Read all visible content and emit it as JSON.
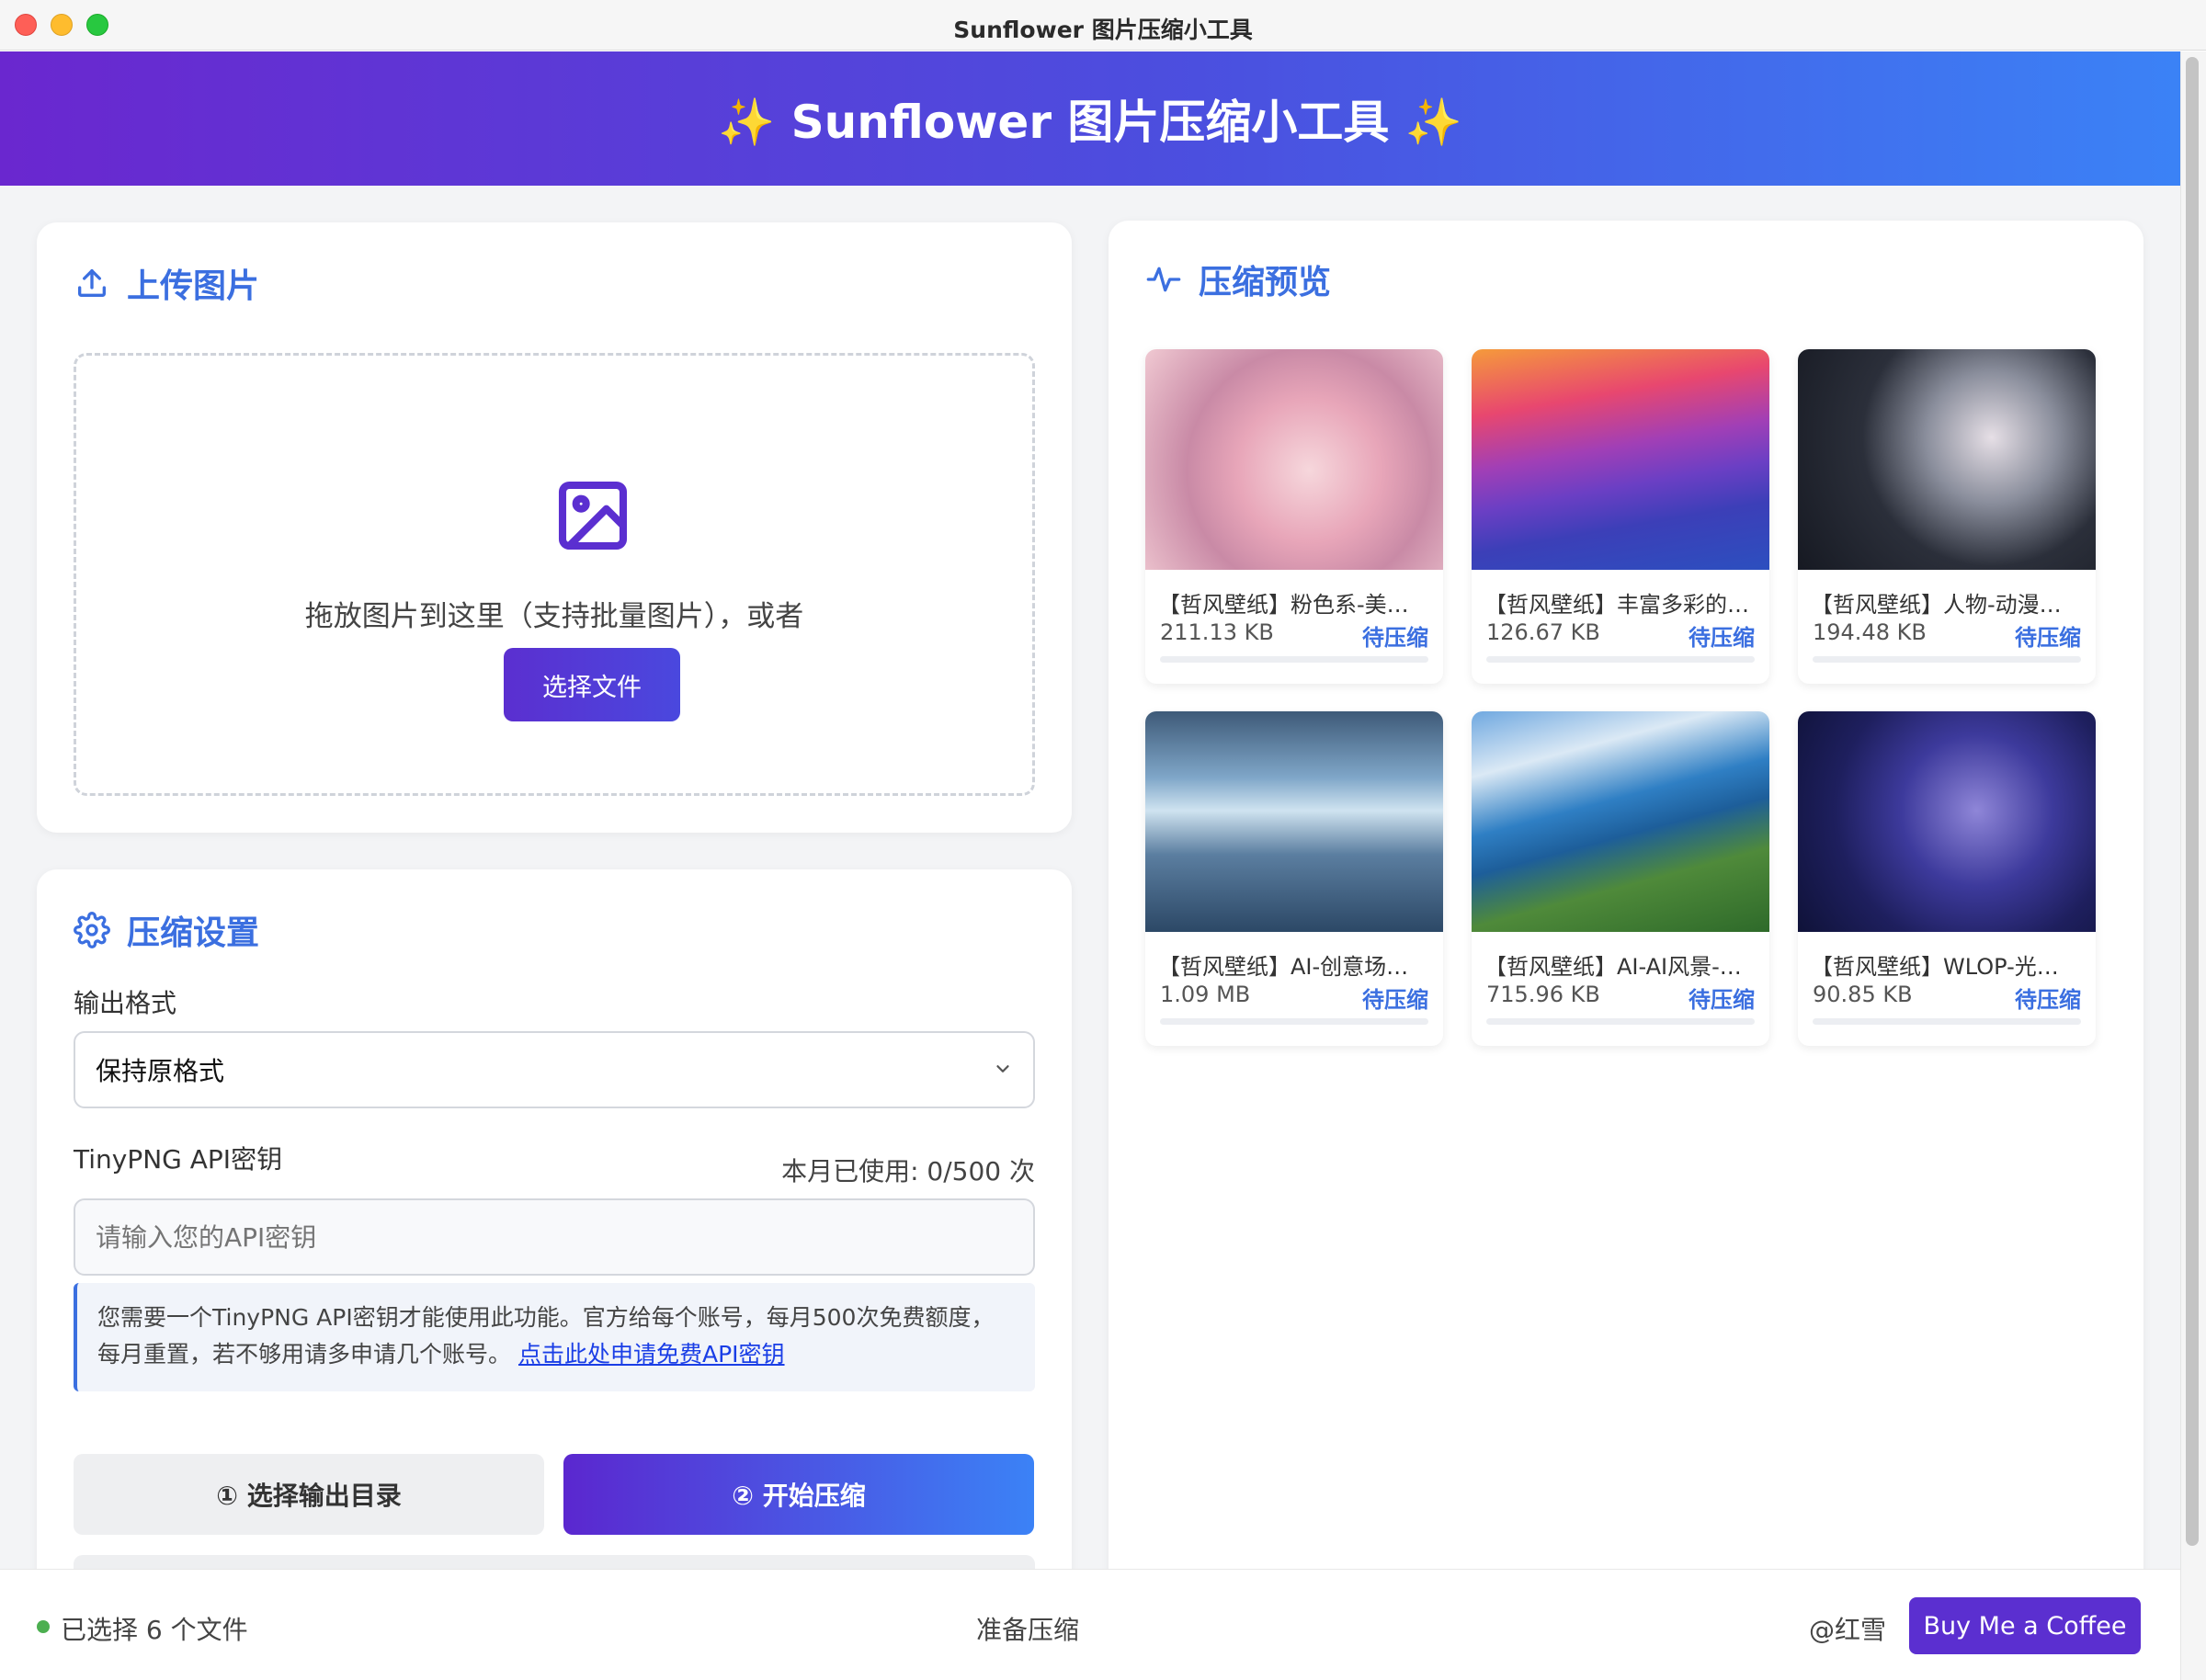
{
  "window": {
    "title": "Sunflower 图片压缩小工具"
  },
  "header": {
    "title": "✨ Sunflower 图片压缩小工具 ✨"
  },
  "upload": {
    "title": "上传图片",
    "drop_text": "拖放图片到这里（支持批量图片），或者",
    "choose_button": "选择文件"
  },
  "settings": {
    "title": "压缩设置",
    "format_label": "输出格式",
    "format_value": "保持原格式",
    "api_label": "TinyPNG API密钥",
    "usage": "本月已使用: 0/500 次",
    "api_placeholder": "请输入您的API密钥",
    "notice_text": "您需要一个TinyPNG API密钥才能使用此功能。官方给每个账号，每月500次免费额度，每月重置，若不够用请多申请几个账号。",
    "notice_link": "点击此处申请免费API密钥",
    "select_dir_button": "① 选择输出目录",
    "start_button": "② 开始压缩"
  },
  "preview": {
    "title": "压缩预览",
    "items": [
      {
        "name": "【哲风壁纸】粉色系-美…",
        "size": "211.13 KB",
        "status": "待压缩"
      },
      {
        "name": "【哲风壁纸】丰富多彩的…",
        "size": "126.67 KB",
        "status": "待压缩"
      },
      {
        "name": "【哲风壁纸】人物-动漫…",
        "size": "194.48 KB",
        "status": "待压缩"
      },
      {
        "name": "【哲风壁纸】AI-创意场…",
        "size": "1.09 MB",
        "status": "待压缩"
      },
      {
        "name": "【哲风壁纸】AI-AI风景-…",
        "size": "715.96 KB",
        "status": "待压缩"
      },
      {
        "name": "【哲风壁纸】WLOP-光…",
        "size": "90.85 KB",
        "status": "待压缩"
      }
    ]
  },
  "statusbar": {
    "selected": "已选择 6 个文件",
    "state": "准备压缩",
    "author": "@红雪",
    "coffee_button": "Buy Me a Coffee"
  },
  "colors": {
    "accent": "#3b6fe0",
    "brand_purple": "#5b2fd0",
    "status_green": "#4caf50"
  }
}
